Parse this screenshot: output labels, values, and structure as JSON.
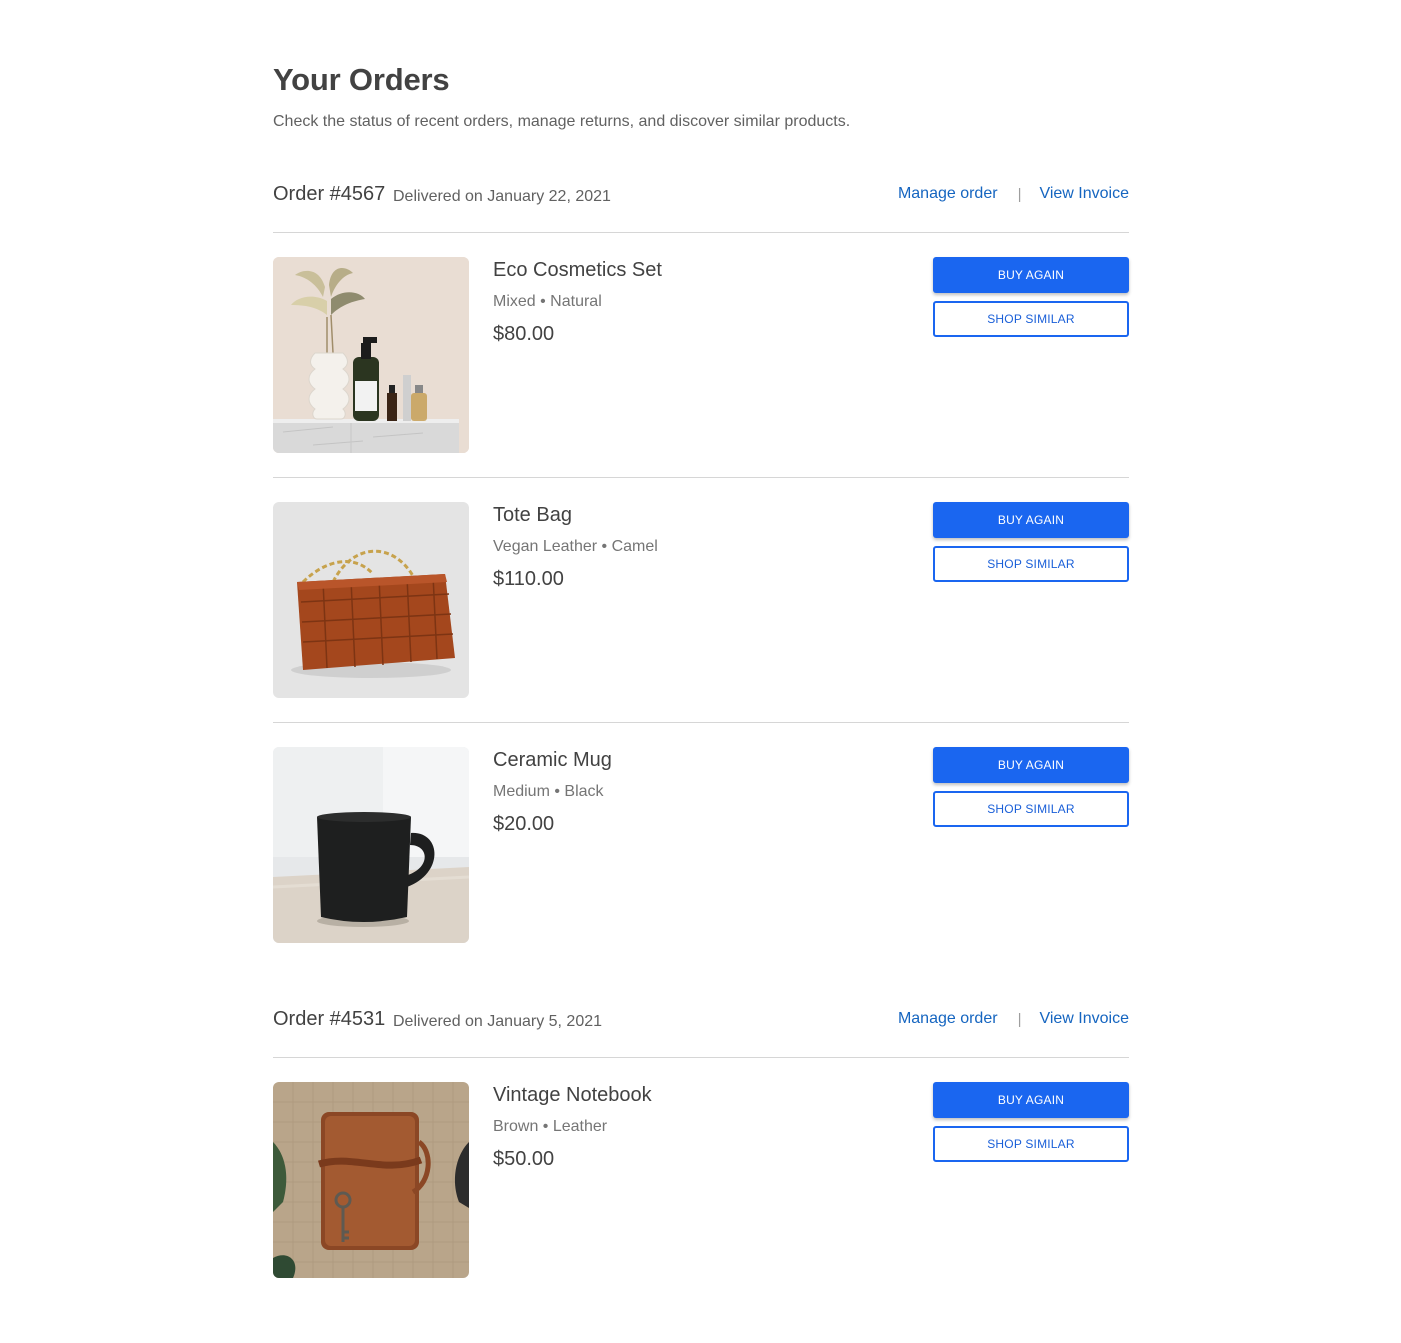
{
  "page": {
    "title": "Your Orders",
    "subtitle": "Check the status of recent orders, manage returns, and discover similar products."
  },
  "colors": {
    "accent": "#1a66f0",
    "link": "#1565c0",
    "text": "#424242",
    "muted": "#757575"
  },
  "orders": [
    {
      "number": "Order #4567",
      "date": "Delivered on January 22, 2021",
      "manage_label": "Manage order",
      "separator": "|",
      "invoice_label": "View Invoice",
      "items": [
        {
          "name": "Eco Cosmetics Set",
          "variant": "Mixed • Natural",
          "price": "$80.00",
          "image": "cosmetics-image",
          "buy_label": "BUY AGAIN",
          "similar_label": "SHOP SIMILAR"
        },
        {
          "name": "Tote Bag",
          "variant": "Vegan Leather • Camel",
          "price": "$110.00",
          "image": "tote-bag-image",
          "buy_label": "BUY AGAIN",
          "similar_label": "SHOP SIMILAR"
        },
        {
          "name": "Ceramic Mug",
          "variant": "Medium • Black",
          "price": "$20.00",
          "image": "mug-image",
          "buy_label": "BUY AGAIN",
          "similar_label": "SHOP SIMILAR"
        }
      ]
    },
    {
      "number": "Order #4531",
      "date": "Delivered on January 5, 2021",
      "manage_label": "Manage order",
      "separator": "|",
      "invoice_label": "View Invoice",
      "items": [
        {
          "name": "Vintage Notebook",
          "variant": "Brown • Leather",
          "price": "$50.00",
          "image": "notebook-image",
          "buy_label": "BUY AGAIN",
          "similar_label": "SHOP SIMILAR"
        }
      ]
    }
  ]
}
